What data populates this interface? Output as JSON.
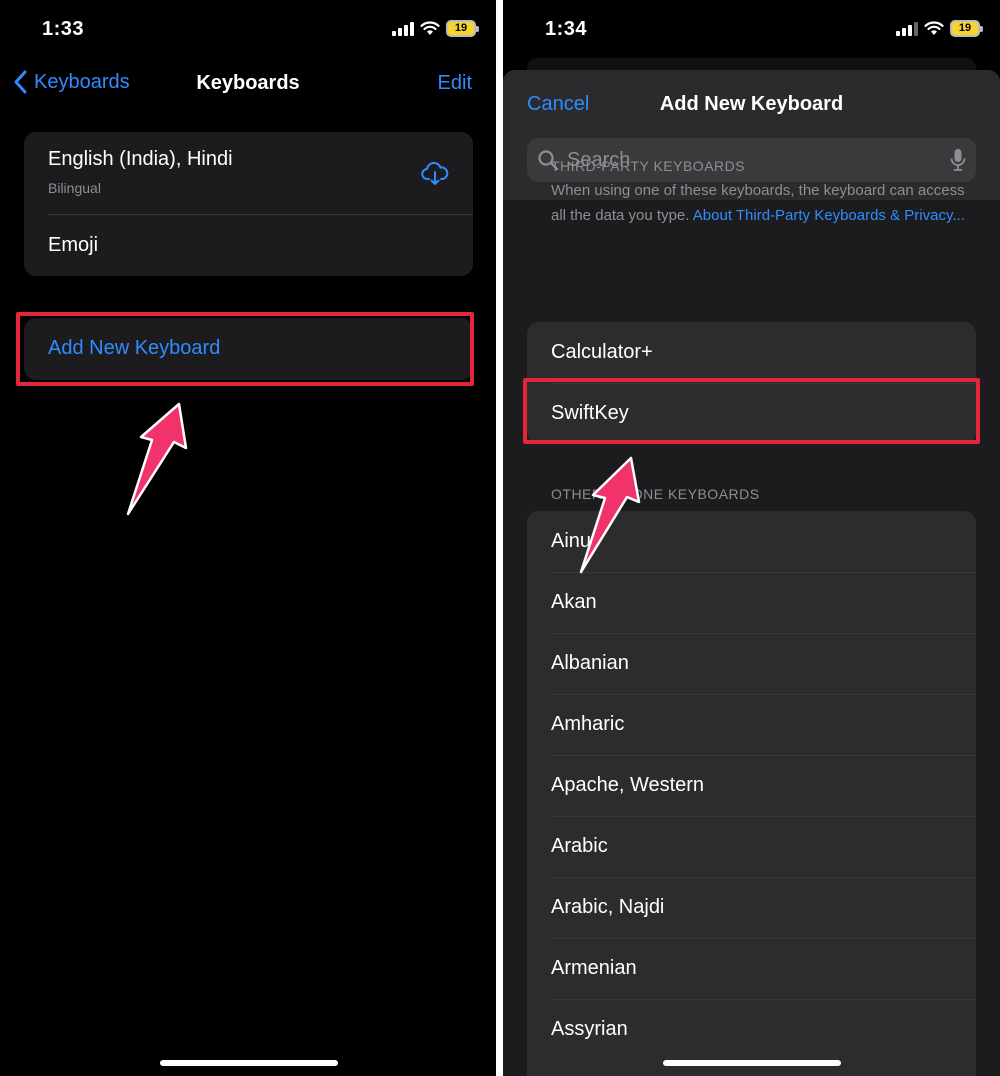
{
  "left": {
    "status": {
      "time": "1:33",
      "battery": "19"
    },
    "nav": {
      "back_label": "Keyboards",
      "title": "Keyboards",
      "edit_label": "Edit"
    },
    "keyboards": [
      {
        "name": "English (India), Hindi",
        "sub": "Bilingual"
      },
      {
        "name": "Emoji"
      }
    ],
    "add_label": "Add New Keyboard"
  },
  "right": {
    "status": {
      "time": "1:34",
      "battery": "19"
    },
    "sheet": {
      "cancel_label": "Cancel",
      "title": "Add New Keyboard"
    },
    "search": {
      "placeholder": "Search"
    },
    "third_party": {
      "header": "THIRD-PARTY KEYBOARDS",
      "desc": "When using one of these keyboards, the keyboard can access all the data you type.",
      "link": "About Third-Party Keyboards & Privacy...",
      "items": [
        "Calculator+",
        "SwiftKey"
      ]
    },
    "other": {
      "header": "OTHER IPHONE KEYBOARDS",
      "items": [
        "Ainu",
        "Akan",
        "Albanian",
        "Amharic",
        "Apache, Western",
        "Arabic",
        "Arabic, Najdi",
        "Armenian",
        "Assyrian"
      ]
    }
  },
  "colors": {
    "accent": "#2f8cff",
    "highlight": "#e3263a",
    "arrow": "#f0336a"
  },
  "icons": [
    "chevron-left-icon",
    "cloud-download-icon",
    "search-icon",
    "microphone-icon",
    "wifi-icon",
    "signal-icon",
    "battery-icon"
  ]
}
